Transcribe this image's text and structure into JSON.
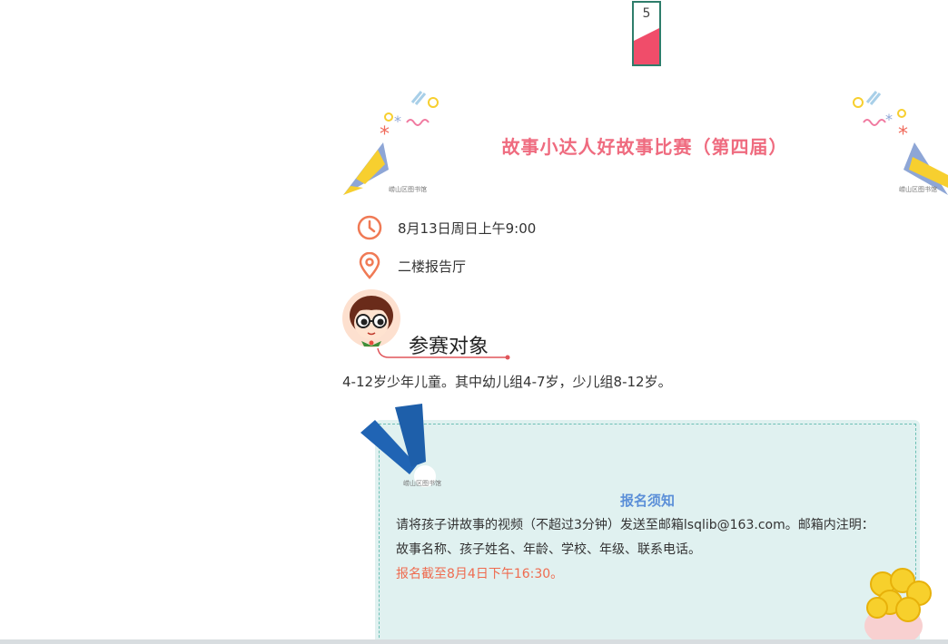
{
  "page_tag": {
    "number": "5"
  },
  "header": {
    "title": "故事小达人好故事比赛（第四届）",
    "watermark": "崂山区图书馆"
  },
  "info": {
    "time": "8月13日周日上午9:00",
    "location": "二楼报告厅",
    "time_icon": "clock-icon",
    "location_icon": "location-pin-icon"
  },
  "target_section": {
    "title": "参赛对象",
    "text": "4-12岁少年儿童。其中幼儿组4-7岁，少儿组8-12岁。"
  },
  "notice": {
    "title": "报名须知",
    "line1": "请将孩子讲故事的视频（不超过3分钟）发送至邮箱lsqlib@163.com。邮箱内注明：",
    "line2": "故事名称、孩子姓名、年龄、学校、年级、联系电话。",
    "deadline": "报名截至8月4日下午16:30。",
    "watermark": "崂山区图书馆"
  },
  "colors": {
    "title_pink": "#ef6b7f",
    "icon_orange": "#f07a55",
    "notice_blue": "#5b8fd8",
    "notice_bg": "#e0f1f0",
    "deadline_red": "#ef6b4f",
    "tag_green": "#2e7d6b"
  }
}
